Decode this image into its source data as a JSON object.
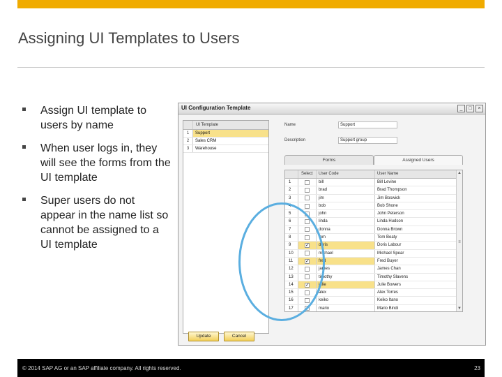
{
  "slide": {
    "title": "Assigning UI Templates to Users",
    "bullets": [
      "Assign UI template to users by name",
      "When user logs in, they will see the forms from the UI template",
      "Super users do not appear in the name list so cannot be assigned to a UI template"
    ],
    "footer_copyright": "© 2014 SAP AG or an SAP affiliate company. All rights reserved.",
    "page_number": "23"
  },
  "window": {
    "title": "UI Configuration Template",
    "buttons": [
      "_",
      "□",
      "×"
    ],
    "template_table": {
      "header": "UI Template",
      "rows": [
        {
          "num": "1",
          "value": "Support"
        },
        {
          "num": "2",
          "value": "Sales CRM"
        },
        {
          "num": "3",
          "value": "Warehouse"
        }
      ]
    },
    "name_label": "Name",
    "name_value": "Support",
    "description_label": "Description",
    "description_value": "Support group",
    "tabs": [
      "Forms",
      "Assigned Users"
    ],
    "users_grid": {
      "columns": [
        "",
        "Select",
        "User Code",
        "User Name"
      ],
      "rows": [
        {
          "num": "1",
          "checked": "",
          "code": "bill",
          "name": "Bill Levine"
        },
        {
          "num": "2",
          "checked": "",
          "code": "brad",
          "name": "Brad Thompson"
        },
        {
          "num": "3",
          "checked": "",
          "code": "jim",
          "name": "Jim Boswick"
        },
        {
          "num": "4",
          "checked": "",
          "code": "bob",
          "name": "Bob Shone"
        },
        {
          "num": "5",
          "checked": "",
          "code": "john",
          "name": "John Peterson"
        },
        {
          "num": "6",
          "checked": "",
          "code": "linda",
          "name": "Linda Hudson"
        },
        {
          "num": "7",
          "checked": "",
          "code": "donna",
          "name": "Donna Brown"
        },
        {
          "num": "8",
          "checked": "",
          "code": "tom",
          "name": "Tom Beaty"
        },
        {
          "num": "9",
          "checked": "✓",
          "code": "doris",
          "name": "Doris Labour"
        },
        {
          "num": "10",
          "checked": "",
          "code": "michael",
          "name": "Michael Spear"
        },
        {
          "num": "11",
          "checked": "✓",
          "code": "fred",
          "name": "Fred Buyer"
        },
        {
          "num": "12",
          "checked": "",
          "code": "james",
          "name": "James Chan"
        },
        {
          "num": "13",
          "checked": "",
          "code": "timothy",
          "name": "Timothy Slavens"
        },
        {
          "num": "14",
          "checked": "✓",
          "code": "julie",
          "name": "Julie Bowers"
        },
        {
          "num": "15",
          "checked": "",
          "code": "alex",
          "name": "Alex Torres"
        },
        {
          "num": "16",
          "checked": "",
          "code": "keiko",
          "name": "Keiko Itano"
        },
        {
          "num": "17",
          "checked": "",
          "code": "mario",
          "name": "Mario Bindi"
        }
      ]
    },
    "update_label": "Update",
    "cancel_label": "Cancel"
  },
  "colors": {
    "top_bar": "#f0ab00",
    "highlight": "#f8e18a",
    "annotation_circle": "#5aaee0"
  }
}
